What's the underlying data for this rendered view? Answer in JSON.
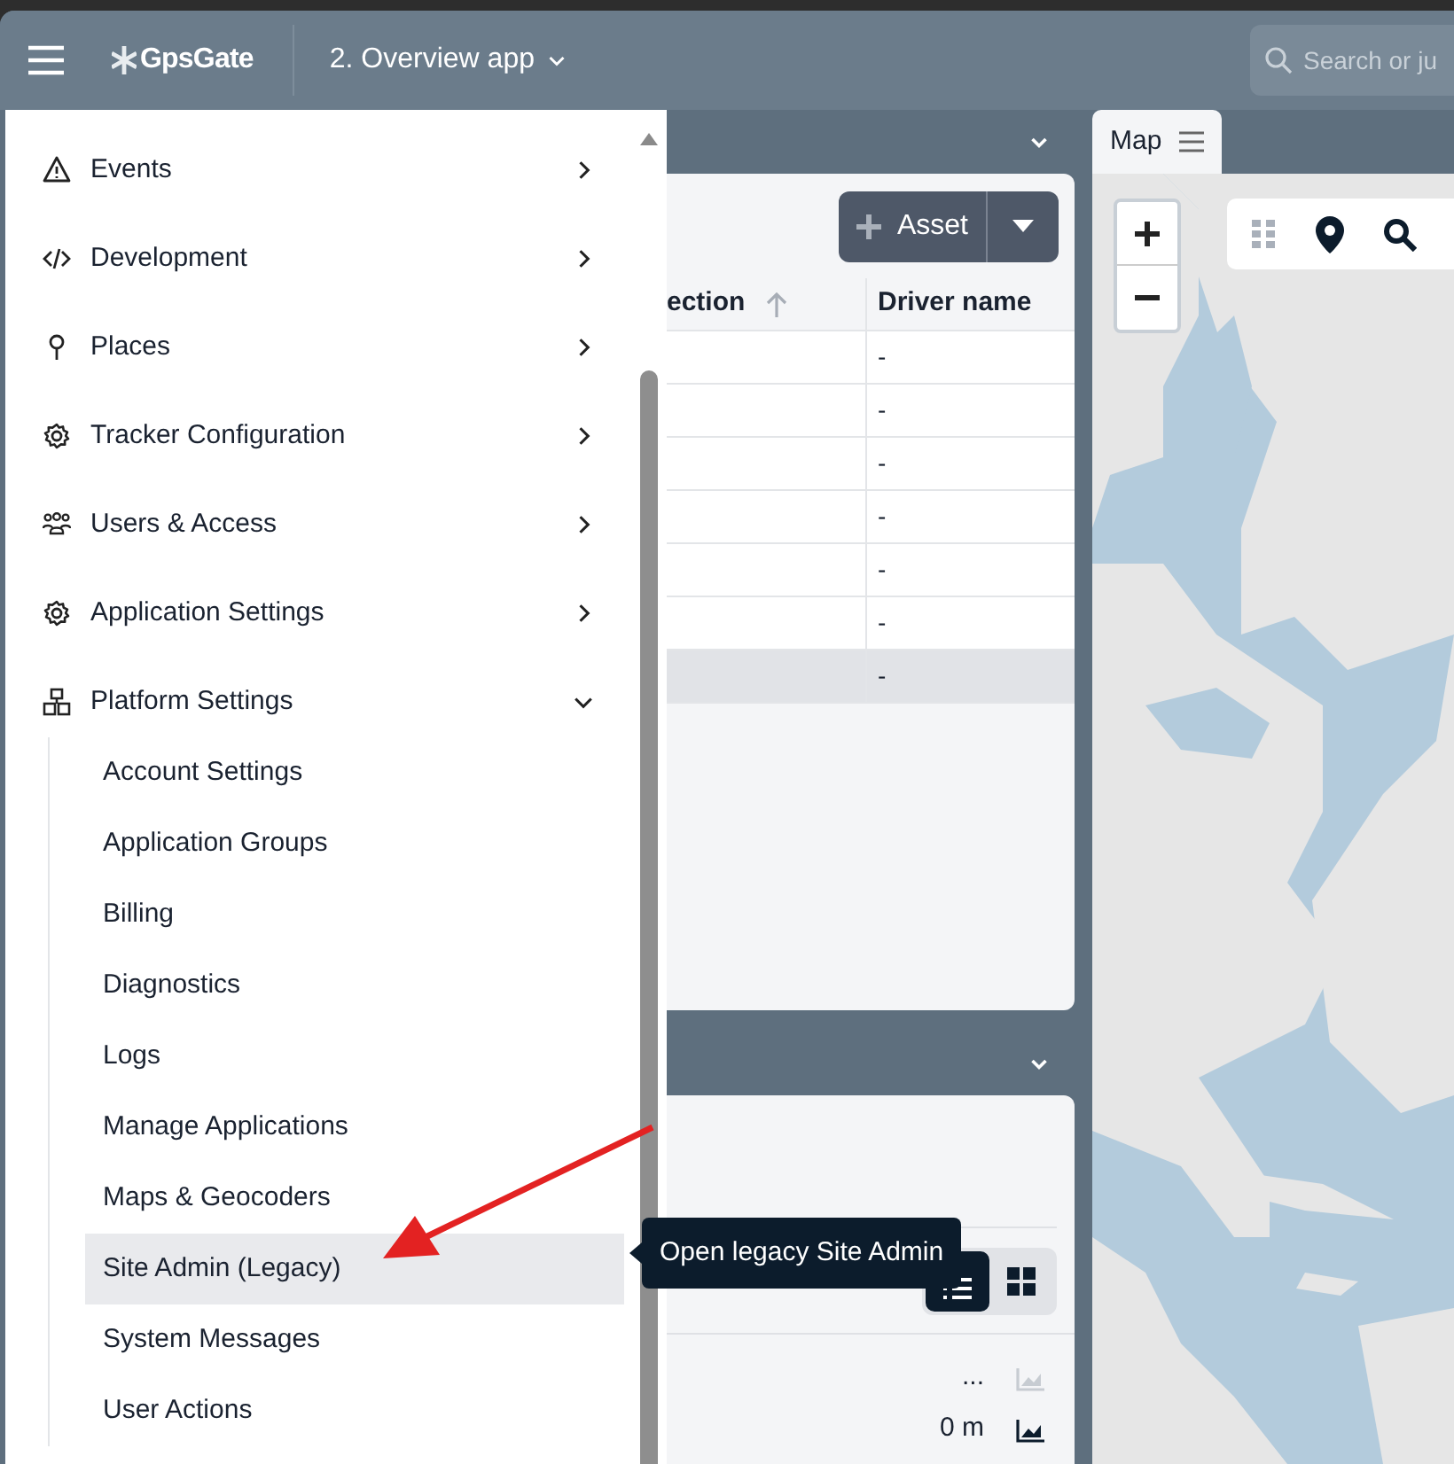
{
  "top_bar": {
    "logo": "GpsGate",
    "app_selector": "2. Overview app",
    "search": {
      "placeholder": "Search or ju"
    }
  },
  "nav_menu": {
    "items": [
      {
        "label": "Events",
        "expanded": false
      },
      {
        "label": "Development",
        "expanded": false
      },
      {
        "label": "Places",
        "expanded": false
      },
      {
        "label": "Tracker Configuration",
        "expanded": false
      },
      {
        "label": "Users & Access",
        "expanded": false
      },
      {
        "label": "Application Settings",
        "expanded": false
      },
      {
        "label": "Platform Settings",
        "expanded": true,
        "children": [
          {
            "label": "Account Settings",
            "selected": false
          },
          {
            "label": "Application Groups",
            "selected": false
          },
          {
            "label": "Billing",
            "selected": false
          },
          {
            "label": "Diagnostics",
            "selected": false
          },
          {
            "label": "Logs",
            "selected": false
          },
          {
            "label": "Manage Applications",
            "selected": false
          },
          {
            "label": "Maps & Geocoders",
            "selected": false
          },
          {
            "label": "Site Admin (Legacy)",
            "selected": true
          },
          {
            "label": "System Messages",
            "selected": false
          },
          {
            "label": "User Actions",
            "selected": false
          }
        ]
      }
    ]
  },
  "tooltip": "Open legacy Site Admin",
  "assets_panel": {
    "add_button": "Asset",
    "columns": [
      "ection",
      "Driver name"
    ],
    "rows": [
      {
        "driver_name": "-",
        "selected": false
      },
      {
        "driver_name": "-",
        "selected": false
      },
      {
        "driver_name": "-",
        "selected": false
      },
      {
        "driver_name": "-",
        "selected": false
      },
      {
        "driver_name": "-",
        "selected": false
      },
      {
        "driver_name": "-",
        "selected": false
      },
      {
        "driver_name": "-",
        "selected": true
      }
    ]
  },
  "bottom_panel": {
    "view_toggle": [
      {
        "kind": "list",
        "selected": true
      },
      {
        "kind": "grid",
        "selected": false
      }
    ],
    "rows": [
      {
        "value": "...",
        "chart_enabled": false
      },
      {
        "value": "0 m",
        "chart_enabled": true
      }
    ]
  },
  "map": {
    "tab": "Map"
  }
}
